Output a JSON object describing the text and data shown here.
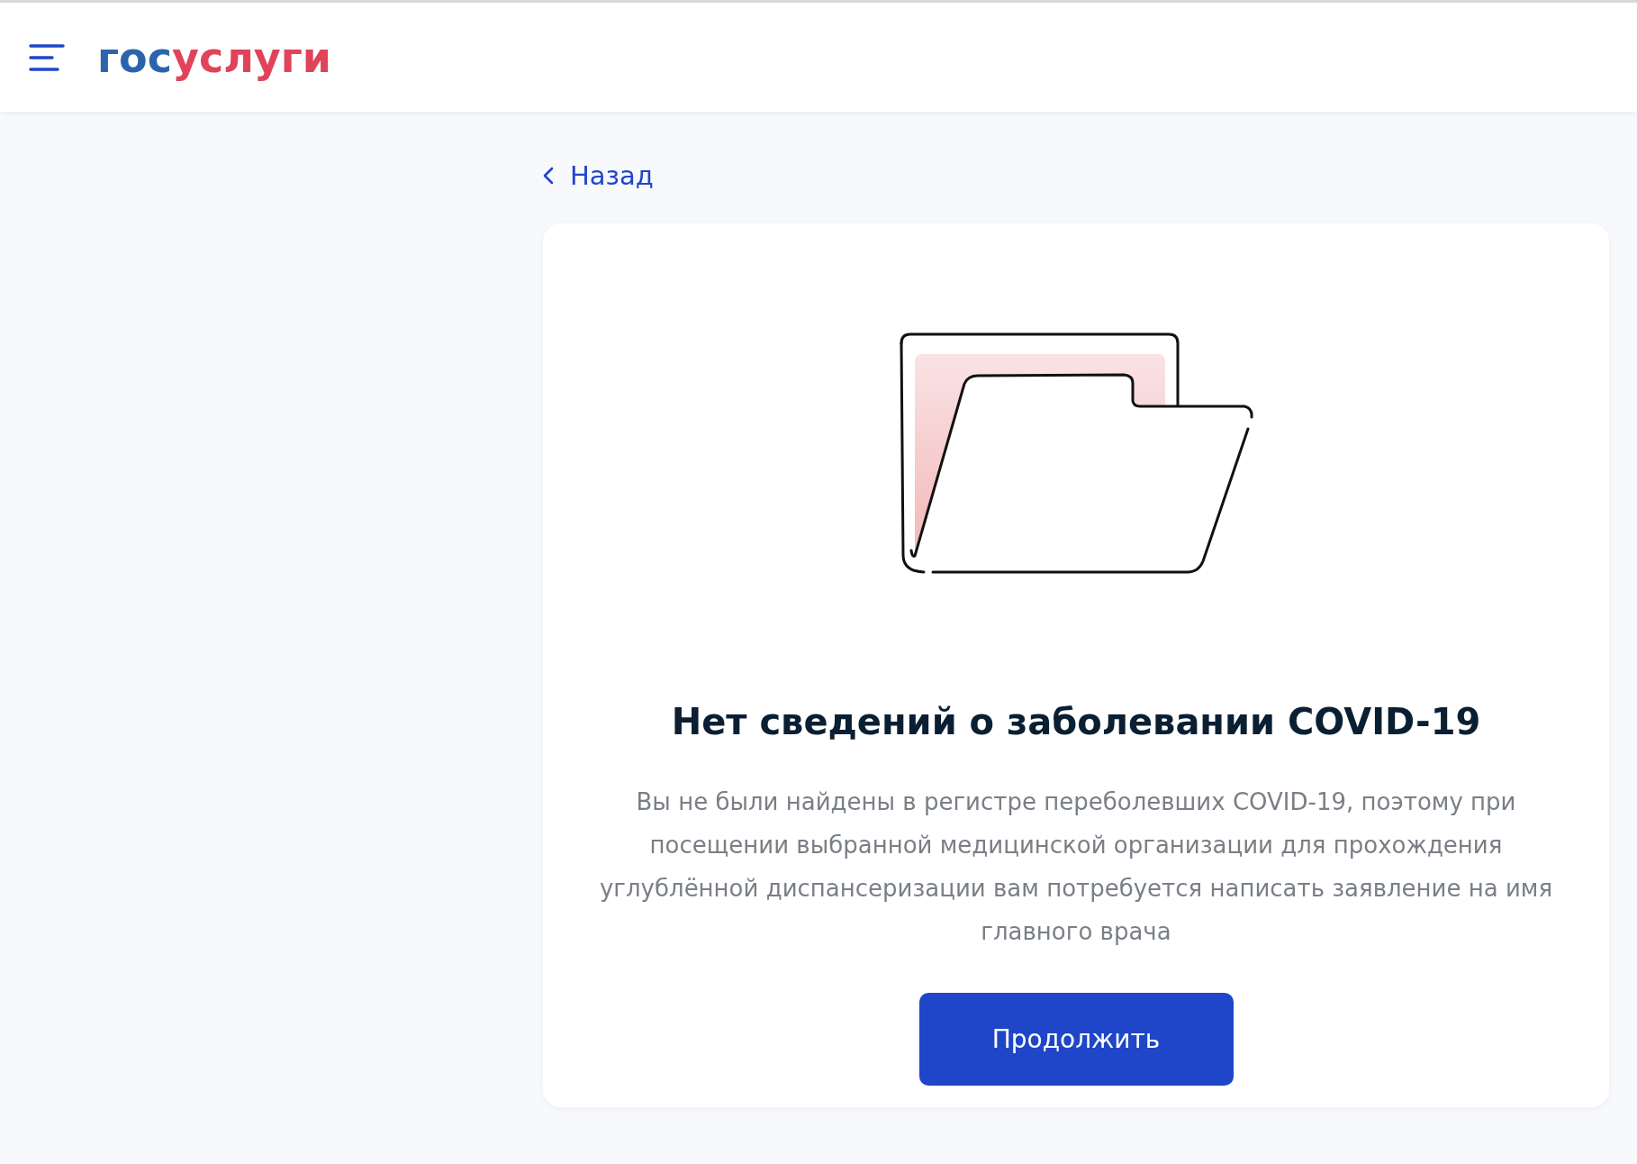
{
  "header": {
    "logo": [
      {
        "text": "гос",
        "color": "#2b64ad"
      },
      {
        "text": "услуги",
        "color": "#e0435a"
      }
    ]
  },
  "back_link": "Назад",
  "card": {
    "title": "Нет сведений о заболевании COVID-19",
    "text": "Вы не были найдены в регистре переболевших COVID-19, поэтому при посещении выбранной медицинской организации для прохождения углублённой диспансеризации вам потребуется написать заявление на имя главного врача",
    "button": "Продолжить"
  }
}
